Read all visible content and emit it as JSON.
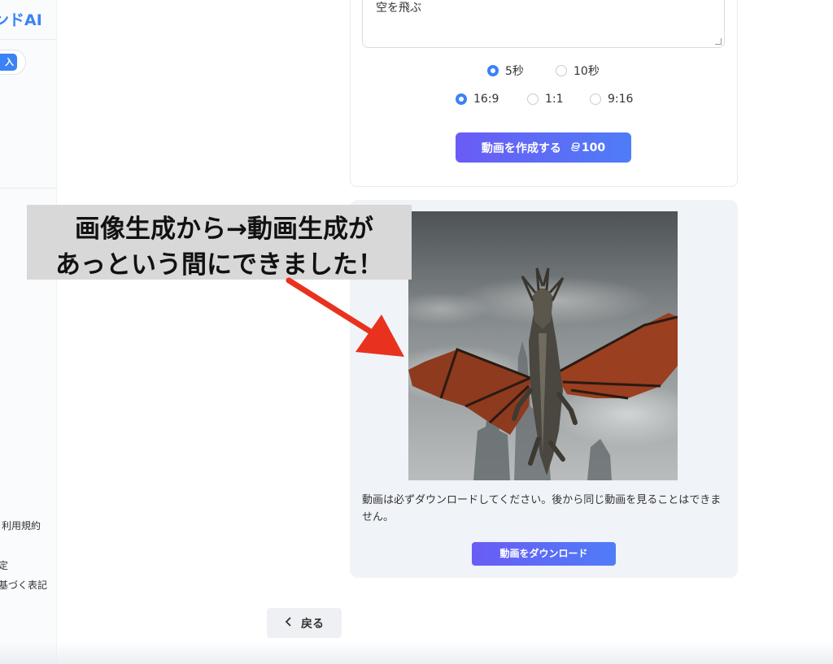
{
  "sidebar": {
    "brand": "ンドAI",
    "buy_label": "入",
    "footer_links": [
      "利用規約",
      "定",
      "基づく表記"
    ]
  },
  "form": {
    "prompt_value": "空を飛ぶ",
    "durations": [
      {
        "label": "5秒",
        "checked": true
      },
      {
        "label": "10秒",
        "checked": false
      }
    ],
    "ratios": [
      {
        "label": "16:9",
        "checked": true
      },
      {
        "label": "1:1",
        "checked": false
      },
      {
        "label": "9:16",
        "checked": false
      }
    ],
    "create_label": "動画を作成する",
    "credit_icon": "coin-stack-icon",
    "credit_cost": "100"
  },
  "result": {
    "notice": "動画は必ずダウンロードしてください。後から同じ動画を見ることはできません。",
    "download_label": "動画をダウンロード"
  },
  "nav": {
    "back_label": "戻る"
  },
  "annotation": {
    "line1": "画像生成から→動画生成が",
    "line2": "あっという間にできました！",
    "arrow_color": "#e8321e"
  },
  "colors": {
    "accent": "#3b82f6",
    "gradient_start": "#6a5cf6",
    "gradient_end": "#4f7cf7"
  }
}
